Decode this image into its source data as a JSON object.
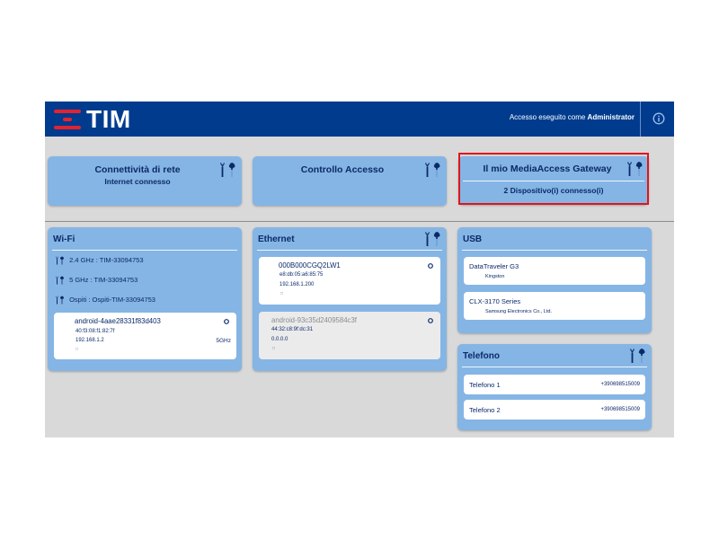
{
  "header": {
    "logo_text": "TIM",
    "access_text": "Accesso eseguito come",
    "access_user": "Administrator",
    "info_icon": "info-icon"
  },
  "top_cards": {
    "connettivita": {
      "title": "Connettività di rete",
      "subtitle": "Internet connesso"
    },
    "controllo": {
      "title": "Controllo Accesso"
    },
    "gateway": {
      "title": "Il mio MediaAccess Gateway",
      "subtitle": "2 Dispositivo(i) connesso(i)"
    }
  },
  "wifi": {
    "title": "Wi-Fi",
    "networks": [
      {
        "band": "2.4 GHz",
        "ssid": ": TIM-33094753"
      },
      {
        "band": "5 GHz",
        "ssid": ": TIM-33094753"
      },
      {
        "band": "Ospiti",
        "ssid": ": Ospiti-TIM-33094753"
      }
    ],
    "device": {
      "name": "android-4aae28331f83d403",
      "mac": "40:f3:08:f1:82:7f",
      "ip": "192.168.1.2",
      "band": "5GHz",
      "extra": "□"
    }
  },
  "ethernet": {
    "title": "Ethernet",
    "devices": [
      {
        "name": "000B000CGQ2LW1",
        "mac": "e8:db:05:a6:85:75",
        "ip": "192.168.1.200",
        "extra": "□"
      },
      {
        "name": "android-93c35d2409584c3f",
        "mac": "44:32:c8:9f:dc:31",
        "ip": "0.0.0.0",
        "extra": "□"
      }
    ]
  },
  "usb": {
    "title": "USB",
    "devices": [
      {
        "name": "DataTraveler G3",
        "vendor": "Kingston"
      },
      {
        "name": "CLX-3170 Series",
        "vendor": "Samsung Electronics Co., Ltd."
      }
    ]
  },
  "telefono": {
    "title": "Telefono",
    "lines": [
      {
        "name": "Telefono 1",
        "number": "+390698515009"
      },
      {
        "name": "Telefono 2",
        "number": "+390698515009"
      }
    ]
  },
  "colors": {
    "header_bg": "#003b8e",
    "card_bg": "#85b5e4",
    "brand_red": "#e3232f",
    "highlight": "#e1141d"
  }
}
